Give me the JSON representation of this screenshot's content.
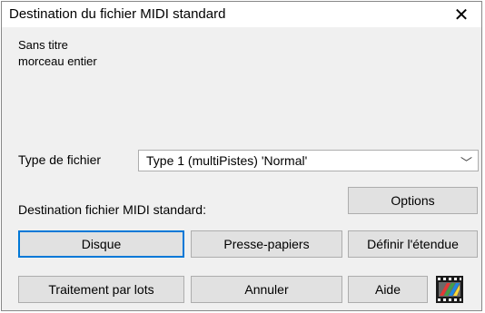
{
  "window": {
    "title": "Destination du fichier MIDI standard",
    "close_label": "✕"
  },
  "info": {
    "song_name": "Sans titre",
    "range": "morceau entier"
  },
  "file_type": {
    "label": "Type de fichier",
    "selected": "Type 1 (multiPistes) 'Normal'"
  },
  "destination": {
    "label": "Destination fichier MIDI standard:"
  },
  "buttons": {
    "options": "Options",
    "disk": "Disque",
    "clipboard": "Presse-papiers",
    "set_range": "Définir l'étendue",
    "batch": "Traitement par lots",
    "cancel": "Annuler",
    "help": "Aide"
  },
  "icons": {
    "chevron": "chevron-down-icon",
    "film": "film-clip-icon"
  },
  "colors": {
    "accent": "#0078d7",
    "button_bg": "#e1e1e1",
    "dialog_bg": "#f0f0f0"
  }
}
